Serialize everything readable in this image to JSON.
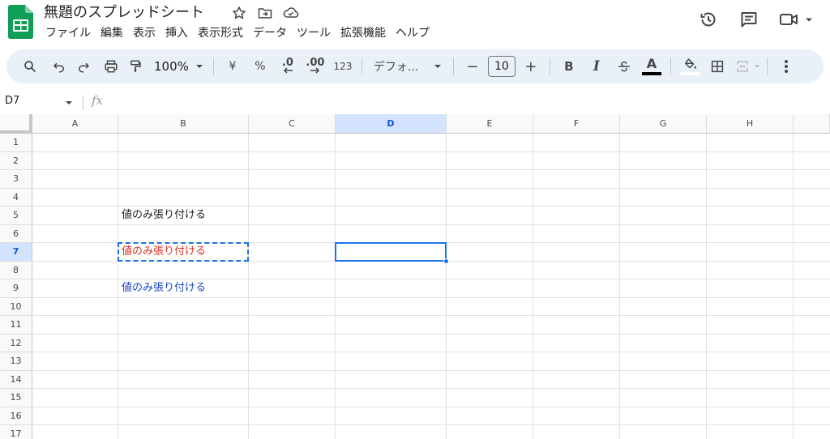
{
  "header": {
    "title": "無題のスプレッドシート",
    "menu": [
      "ファイル",
      "編集",
      "表示",
      "挿入",
      "表示形式",
      "データ",
      "ツール",
      "拡張機能",
      "ヘルプ"
    ]
  },
  "toolbar": {
    "zoom": "100%",
    "currency": "¥",
    "percent": "%",
    "decimal_decrease": ".0",
    "decimal_increase": ".00",
    "number_format": "123",
    "font": "デフォ...",
    "font_size": "10",
    "minus": "−",
    "plus": "+",
    "bold": "B",
    "italic": "I",
    "text_color": "A"
  },
  "formula_bar": {
    "name_box": "D7",
    "fx": "fx"
  },
  "grid": {
    "columns": [
      "A",
      "B",
      "C",
      "D",
      "E",
      "F",
      "G",
      "H"
    ],
    "rows": [
      "1",
      "2",
      "3",
      "4",
      "5",
      "6",
      "7",
      "8",
      "9",
      "10",
      "11",
      "12",
      "13",
      "14",
      "15",
      "16",
      "17"
    ],
    "active_column": "D",
    "active_row": "7",
    "cells": {
      "B5": "値のみ張り付ける",
      "B7": "値のみ張り付ける",
      "B9": "値のみ張り付ける"
    }
  },
  "colors": {
    "accent": "#1a73e8",
    "b5_text": "#1f1f1f",
    "b7_text": "#d93025",
    "b9_text": "#1a47c4",
    "sheets_green": "#0f9d58"
  }
}
